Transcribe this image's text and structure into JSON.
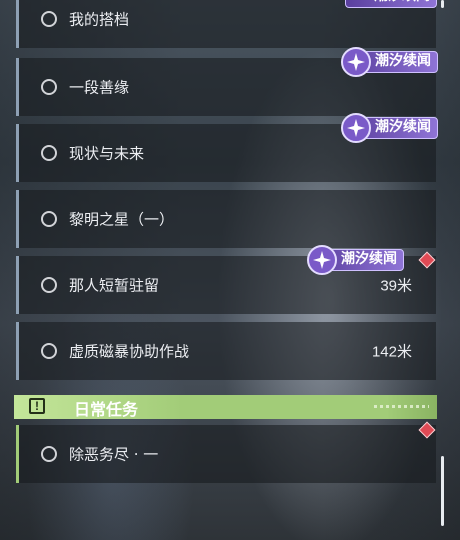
{
  "quests": [
    {
      "name": "我的搭档",
      "distance": ""
    },
    {
      "name": "一段善缘",
      "distance": ""
    },
    {
      "name": "现状与未来",
      "distance": ""
    },
    {
      "name": "黎明之星（一）",
      "distance": ""
    },
    {
      "name": "那人短暂驻留",
      "distance": "39米"
    },
    {
      "name": "虚质磁暴协助作战",
      "distance": "142米"
    }
  ],
  "badge_label": "潮汐续闻",
  "daily_section": {
    "icon": "!",
    "title": "日常任务",
    "quests": [
      {
        "name": "除恶务尽 · 一",
        "distance": ""
      }
    ]
  },
  "colors": {
    "main_quest_accent": "#8ea0b4",
    "daily_accent": "#a2cc78",
    "badge_purple": "#7a5ac8",
    "marker_red": "#e04a55"
  },
  "icons": {
    "quest_status": "circle-icon",
    "badge": "tidal-sparkle-icon",
    "tracking_marker": "diamond-marker-icon",
    "daily_header": "exclamation-icon"
  }
}
